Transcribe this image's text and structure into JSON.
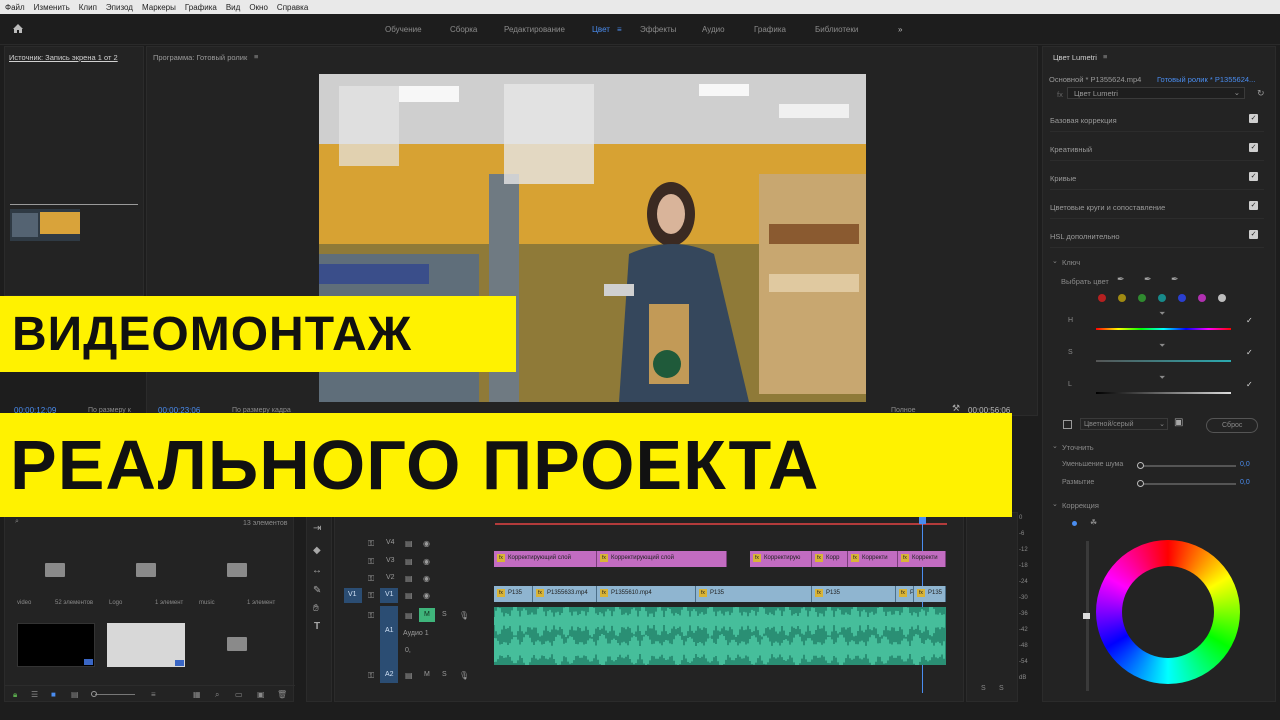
{
  "menu": [
    "Файл",
    "Изменить",
    "Клип",
    "Эпизод",
    "Маркеры",
    "Графика",
    "Вид",
    "Окно",
    "Справка"
  ],
  "workspaces": [
    "Обучение",
    "Сборка",
    "Редактирование",
    "Цвет",
    "Эффекты",
    "Аудио",
    "Графика",
    "Библиотеки"
  ],
  "active_workspace": "Цвет",
  "source_panel": {
    "title": "Источник: Запись экрена 1 от 2",
    "timecode": "00:00:12:09",
    "fit": "По размеру к"
  },
  "program_panel": {
    "title": "Программа: Готовый ролик",
    "timecode": "00:00:23:06",
    "fit": "По размеру кадра",
    "quality": "Полное",
    "duration": "00:00:56:06"
  },
  "project": {
    "count": "13 элементов",
    "bins": [
      {
        "name": "video",
        "count": "52 элементов"
      },
      {
        "name": "Logo",
        "count": "1 элемент"
      },
      {
        "name": "music",
        "count": "1 элемент"
      }
    ]
  },
  "timeline": {
    "tracks": [
      "V4",
      "V3",
      "V2",
      "V1",
      "A1",
      "A2"
    ],
    "src_v": "V1",
    "audio_label": "Аудио 1",
    "audio_value": "0,",
    "m": "M",
    "s": "S",
    "adj_clips": [
      "Корректирующий слой",
      "Корректирующий слой",
      "Корректирую",
      "Корр",
      "Корректи",
      "Корректи"
    ],
    "video_clips": [
      "P135",
      "P1355633.mp4",
      "P1355610.mp4",
      "P135",
      "P135",
      "P135",
      "P135"
    ],
    "meter_scale": [
      "0",
      "-6",
      "-12",
      "-18",
      "-24",
      "-30",
      "-36",
      "-42",
      "-48",
      "-54",
      "dB"
    ]
  },
  "lumetri": {
    "title": "Цвет Lumetri",
    "source": "Основной * P1355624.mp4",
    "target": "Готовый ролик * P1355624...",
    "effect": "Цвет Lumetri",
    "sections": [
      "Базовая коррекция",
      "Креативный",
      "Кривые",
      "Цветовые круги и сопоставление",
      "HSL дополнительно"
    ],
    "key_label": "Ключ",
    "pick_color": "Выбрать цвет",
    "hsl": [
      "H",
      "S",
      "L"
    ],
    "bw": "Цветной/серый",
    "reset": "Сброс",
    "refine": "Уточнить",
    "denoise": "Уменьшение шума",
    "denoise_val": "0,0",
    "blur": "Размытие",
    "blur_val": "0,0",
    "correction": "Коррекция",
    "swatches": [
      "#b52020",
      "#a08a12",
      "#2f8a2f",
      "#178a8a",
      "#2a3fd0",
      "#b030b0",
      "#bdbdbd"
    ]
  },
  "banner": {
    "line1": "ВИДЕОМОНТАЖ",
    "line2": "РЕАЛЬНОГО ПРОЕКТА"
  }
}
